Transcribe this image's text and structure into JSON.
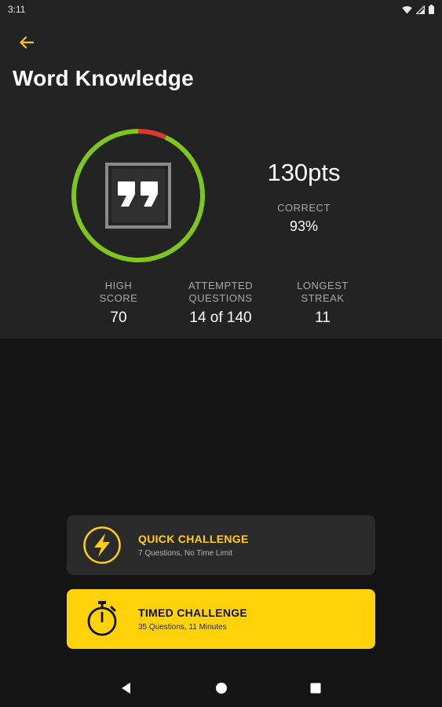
{
  "status_bar": {
    "time": "3:11",
    "icons": [
      "wifi-icon",
      "signal-icon",
      "battery-icon"
    ]
  },
  "header": {
    "back_icon": "arrow-left-icon",
    "title": "Word Knowledge"
  },
  "summary": {
    "category_icon": "quote-icon",
    "points": "130pts",
    "correct_label": "CORRECT",
    "correct_value": "93%",
    "ring": {
      "correct_fraction": 0.93,
      "correct_color": "#7ec51d",
      "incorrect_color": "#d93a2b"
    }
  },
  "stats": [
    {
      "label_line1": "HIGH",
      "label_line2": "SCORE",
      "value": "70"
    },
    {
      "label_line1": "ATTEMPTED",
      "label_line2": "QUESTIONS",
      "value": "14 of 140"
    },
    {
      "label_line1": "LONGEST",
      "label_line2": "STREAK",
      "value": "11"
    }
  ],
  "challenges": {
    "quick": {
      "icon": "lightning-icon",
      "title": "QUICK CHALLENGE",
      "subtitle": "7 Questions, No Time Limit"
    },
    "timed": {
      "icon": "stopwatch-icon",
      "title": "TIMED CHALLENGE",
      "subtitle": "35 Questions, 11 Minutes"
    }
  },
  "nav_bar": {
    "icons": [
      "back-triangle-icon",
      "home-circle-icon",
      "recents-square-icon"
    ]
  },
  "colors": {
    "accent": "#ffd20a",
    "panel": "#232323",
    "background": "#141414"
  }
}
